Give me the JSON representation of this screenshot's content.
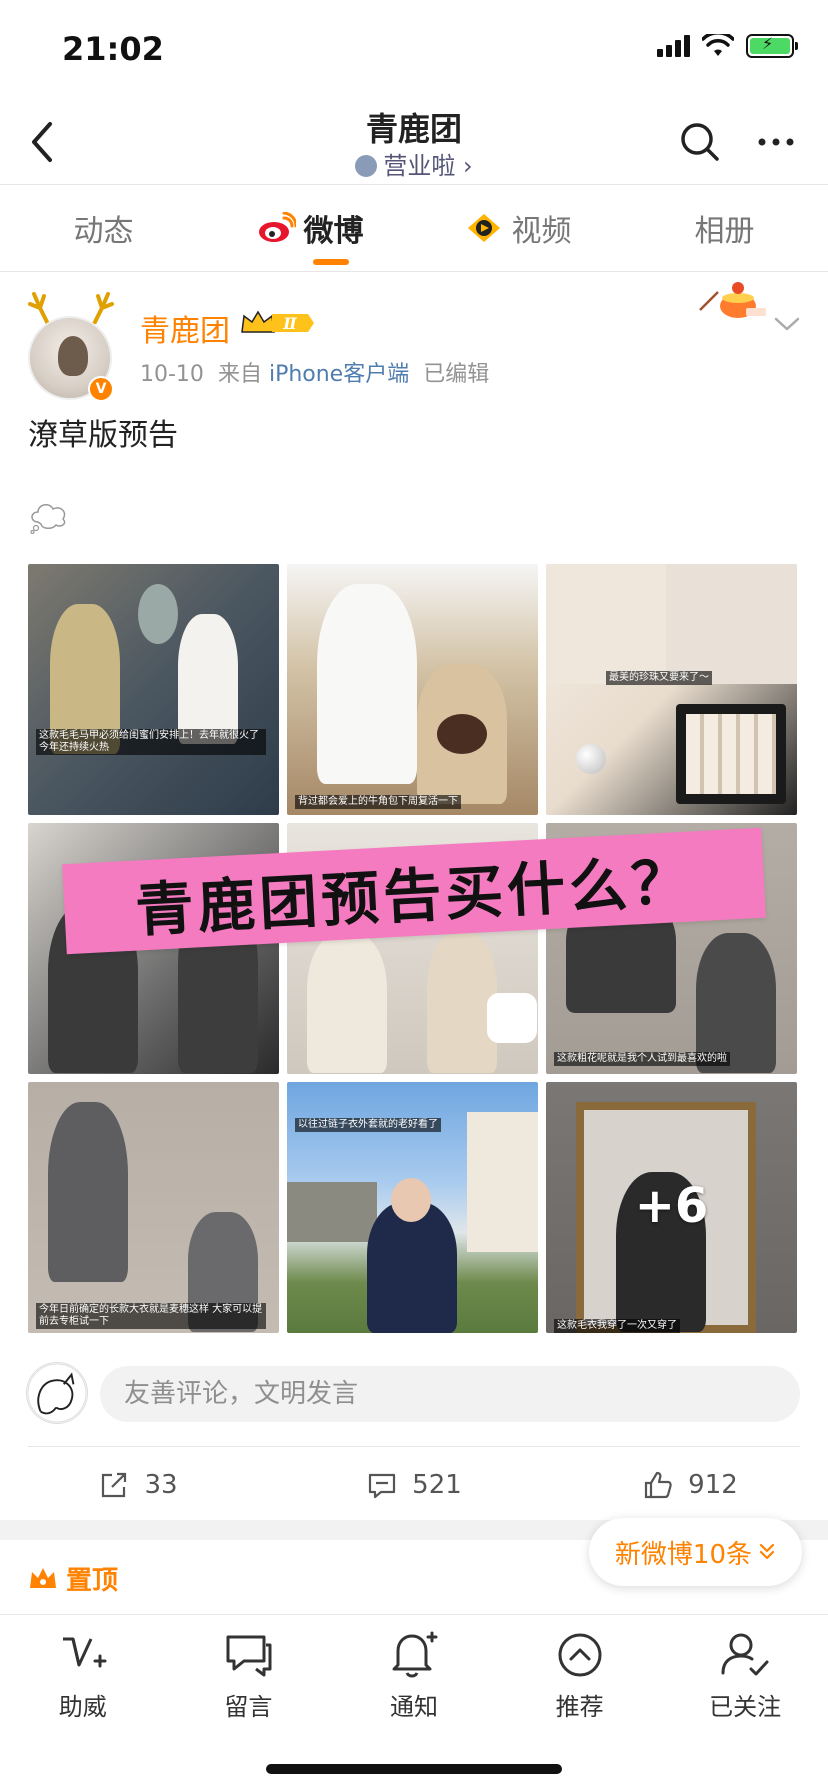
{
  "status_bar": {
    "time": "21:02"
  },
  "nav": {
    "title": "青鹿团",
    "subtitle": "营业啦 ›"
  },
  "tabs": [
    {
      "label": "动态",
      "active": false
    },
    {
      "label": "微博",
      "active": true
    },
    {
      "label": "视频",
      "active": false
    },
    {
      "label": "相册",
      "active": false
    }
  ],
  "post": {
    "author": "青鹿团",
    "vip_level": "Ⅱ",
    "date": "10-10",
    "source_prefix": "来自",
    "source": "iPhone客户端",
    "edited": "已编辑",
    "text": "潦草版预告",
    "banner_text": "青鹿团预告买什么？",
    "more_images": "+6",
    "captions": {
      "img1": "这款毛毛马甲必须给闺蜜们安排上！去年就很火了 今年还持续火热",
      "img2": "背过都会爱上的牛角包下周复活一下",
      "img3": "最美的珍珠又要来了～",
      "img6": "这款粗花呢就是我个人试到最喜欢的啦",
      "img7": "今年日前确定的长款大衣就是麦穗这样 大家可以提前去专柜试一下",
      "img8": "以往过链子衣外套就的老好看了",
      "img9": "这款毛衣我穿了一次又穿了"
    }
  },
  "comment": {
    "placeholder": "友善评论，文明发言"
  },
  "actions": {
    "repost_count": "33",
    "comment_count": "521",
    "like_count": "912"
  },
  "pinned_label": "置顶",
  "new_posts": "新微博10条",
  "bottom_bar": [
    {
      "label": "助威",
      "icon": "boost-icon"
    },
    {
      "label": "留言",
      "icon": "message-icon"
    },
    {
      "label": "通知",
      "icon": "bell-icon"
    },
    {
      "label": "推荐",
      "icon": "recommend-icon"
    },
    {
      "label": "已关注",
      "icon": "followed-icon"
    }
  ],
  "colors": {
    "accent": "#ff8200",
    "link": "#507daf",
    "banner": "#f57bc0"
  }
}
